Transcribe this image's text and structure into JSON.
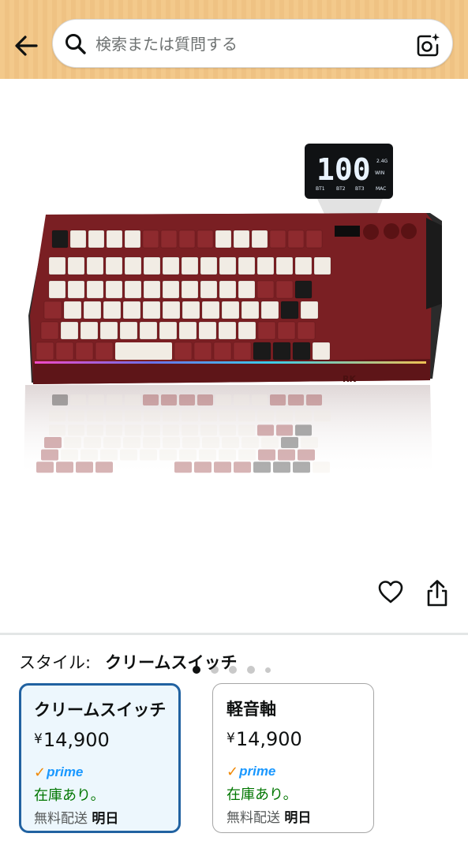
{
  "header": {
    "search_placeholder": "検索または質問する",
    "back_icon": "arrow-left-icon",
    "search_icon": "search-icon",
    "camera_icon": "camera-sparkle-icon",
    "background_color": "#f3c98b"
  },
  "product_image": {
    "display_text": "100",
    "display_small": [
      "2.4G",
      "WIN"
    ],
    "display_bottom": [
      "BT1",
      "BT2",
      "BT3",
      "MAC"
    ],
    "brand_mark": "RK",
    "carousel": {
      "total_dots": 5,
      "active_index": 0
    }
  },
  "actions": {
    "favorite_icon": "heart-outline-icon",
    "share_icon": "share-icon"
  },
  "style_section": {
    "label": "スタイル:",
    "selected_value": "クリームスイッチ"
  },
  "variants": [
    {
      "name": "クリームスイッチ",
      "currency": "¥",
      "price": "14,900",
      "prime_check": "✓",
      "prime_label": "prime",
      "stock": "在庫あり。",
      "shipping_label": "無料配送",
      "shipping_day": "明日",
      "selected": true
    },
    {
      "name": "軽音軸",
      "currency": "¥",
      "price": "14,900",
      "prime_check": "✓",
      "prime_label": "prime",
      "stock": "在庫あり。",
      "shipping_label": "無料配送",
      "shipping_day": "明日",
      "selected": false
    }
  ],
  "colors": {
    "accent_blue": "#2162a1",
    "prime_blue": "#1a98ff",
    "prime_orange": "#f08804",
    "stock_green": "#007600",
    "keyboard_red": "#7a1f23"
  }
}
